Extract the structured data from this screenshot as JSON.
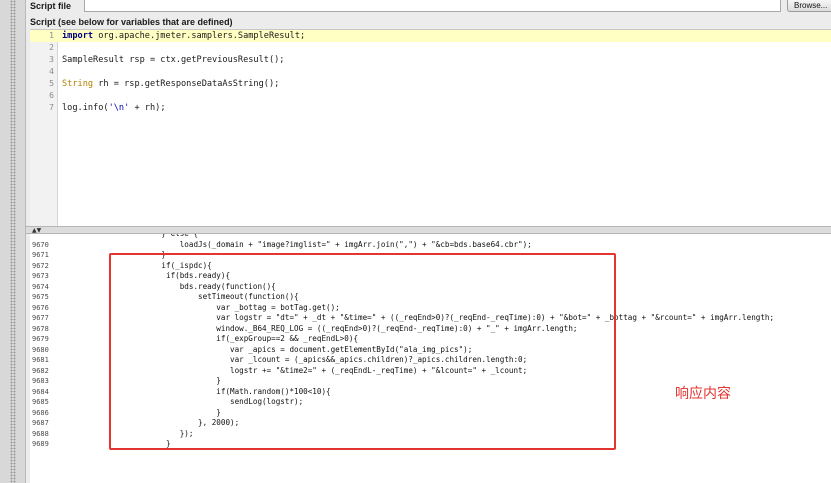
{
  "script_file": {
    "label": "Script file",
    "browse_label": "Browse..."
  },
  "script": {
    "label": "Script (see below for variables that are defined)",
    "lines": [
      {
        "num": "1",
        "parts": [
          {
            "t": "import",
            "c": "kw"
          },
          {
            "t": " org.apache.jmeter.samplers.SampleResult;",
            "c": ""
          }
        ]
      },
      {
        "num": "2",
        "parts": []
      },
      {
        "num": "3",
        "parts": [
          {
            "t": "SampleResult rsp = ctx.getPreviousResult();",
            "c": ""
          }
        ]
      },
      {
        "num": "4",
        "parts": []
      },
      {
        "num": "5",
        "parts": [
          {
            "t": "String",
            "c": "ty"
          },
          {
            "t": " rh = rsp.getResponseDataAsString();",
            "c": ""
          }
        ]
      },
      {
        "num": "6",
        "parts": []
      },
      {
        "num": "7",
        "parts": [
          {
            "t": "log.info(",
            "c": ""
          },
          {
            "t": "'\\n'",
            "c": "str"
          },
          {
            "t": " + rh);",
            "c": ""
          }
        ]
      }
    ]
  },
  "response": {
    "lines": [
      {
        "num": "",
        "code": "                    } else {"
      },
      {
        "num": "9670",
        "code": "                        loadJs(_domain + \"image?imglist=\" + imgArr.join(\",\") + \"&cb=bds.base64.cbr\");"
      },
      {
        "num": "9671",
        "code": "                    }"
      },
      {
        "num": "9672",
        "code": "                    if(_ispdc){"
      },
      {
        "num": "9673",
        "code": "                     if(bds.ready){"
      },
      {
        "num": "9674",
        "code": "                        bds.ready(function(){"
      },
      {
        "num": "9675",
        "code": "                            setTimeout(function(){"
      },
      {
        "num": "9676",
        "code": "                                var _bottag = botTag.get();"
      },
      {
        "num": "9677",
        "code": "                                var logstr = \"dt=\" + _dt + \"&time=\" + ((_reqEnd>0)?(_reqEnd-_reqTime):0) + \"&bot=\" + _bottag + \"&rcount=\" + imgArr.length;"
      },
      {
        "num": "9678",
        "code": "                                window._B64_REQ_LOG = ((_reqEnd>0)?(_reqEnd-_reqTime):0) + \"_\" + imgArr.length;"
      },
      {
        "num": "9679",
        "code": "                                if(_expGroup==2 && _reqEndL>0){"
      },
      {
        "num": "9680",
        "code": "                                   var _apics = document.getElementById(\"ala_img_pics\");"
      },
      {
        "num": "9681",
        "code": "                                   var _lcount = (_apics&&_apics.children)?_apics.children.length:0;"
      },
      {
        "num": "9682",
        "code": "                                   logstr += \"&time2=\" + (_reqEndL-_reqTime) + \"&lcount=\" + _lcount;"
      },
      {
        "num": "9683",
        "code": "                                }"
      },
      {
        "num": "9684",
        "code": "                                if(Math.random()*100<10){"
      },
      {
        "num": "9685",
        "code": "                                   sendLog(logstr);"
      },
      {
        "num": "9686",
        "code": "                                }"
      },
      {
        "num": "9687",
        "code": "                            }, 2000);"
      },
      {
        "num": "9688",
        "code": "                        });"
      },
      {
        "num": "9689",
        "code": "                     }"
      }
    ]
  },
  "annotation": {
    "text": "响应内容",
    "color": "#e3342f"
  }
}
